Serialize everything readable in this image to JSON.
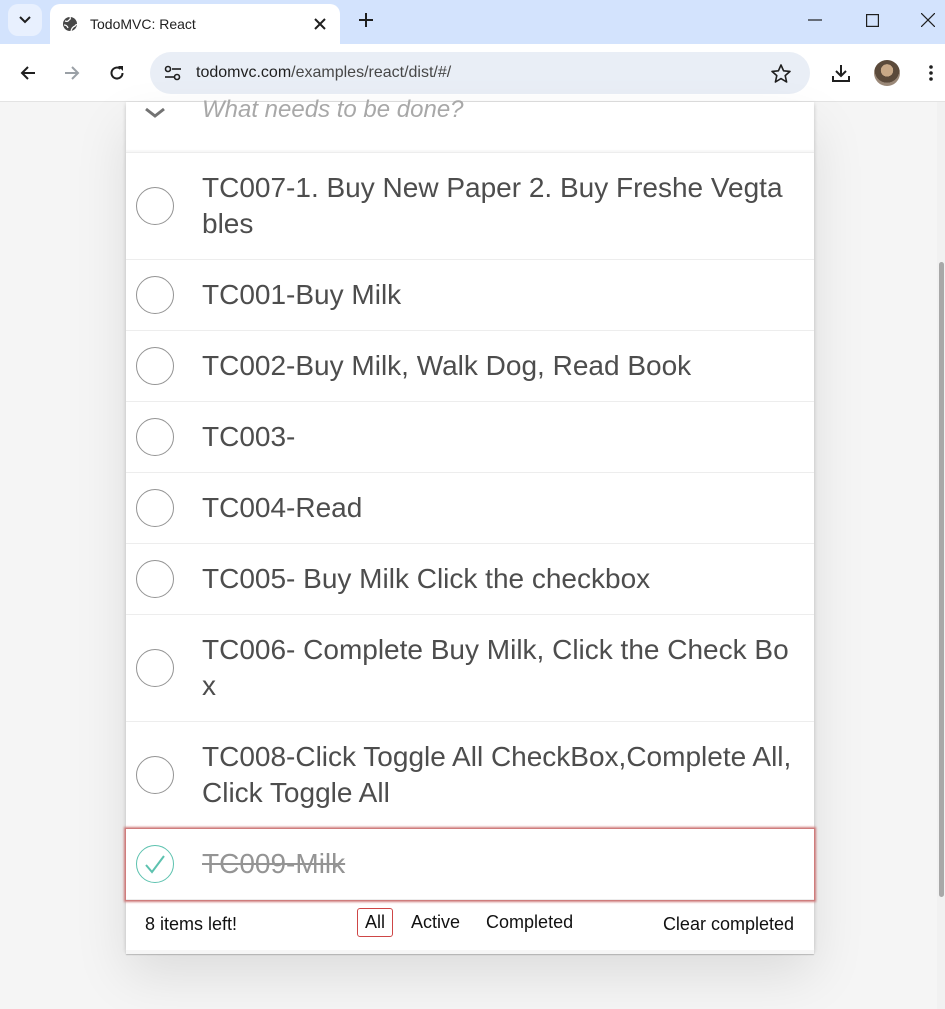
{
  "browser": {
    "tab_title": "TodoMVC: React",
    "url_host": "todomvc.com",
    "url_path": "/examples/react/dist/#/"
  },
  "app": {
    "placeholder": "What needs to be done?",
    "todos": [
      {
        "label": "TC007-1. Buy New Paper 2. Buy Freshe Vegtables",
        "completed": false
      },
      {
        "label": "TC001-Buy Milk",
        "completed": false
      },
      {
        "label": "TC002-Buy Milk, Walk Dog, Read Book",
        "completed": false
      },
      {
        "label": "TC003-",
        "completed": false
      },
      {
        "label": "TC004-Read",
        "completed": false
      },
      {
        "label": "TC005- Buy Milk Click the checkbox",
        "completed": false
      },
      {
        "label": "TC006- Complete Buy Milk, Click the Check Box",
        "completed": false
      },
      {
        "label": "TC008-Click Toggle All CheckBox,Complete All, Click Toggle All",
        "completed": false
      },
      {
        "label": "TC009-Milk",
        "completed": true
      }
    ],
    "footer": {
      "count": "8 items left!",
      "filters": [
        "All",
        "Active",
        "Completed"
      ],
      "selected_filter": "All",
      "clear": "Clear completed"
    }
  },
  "colors": {
    "tabbar": "#d3e3fd",
    "selected_border": "#ce4646",
    "completed_check": "#5dc2af"
  }
}
